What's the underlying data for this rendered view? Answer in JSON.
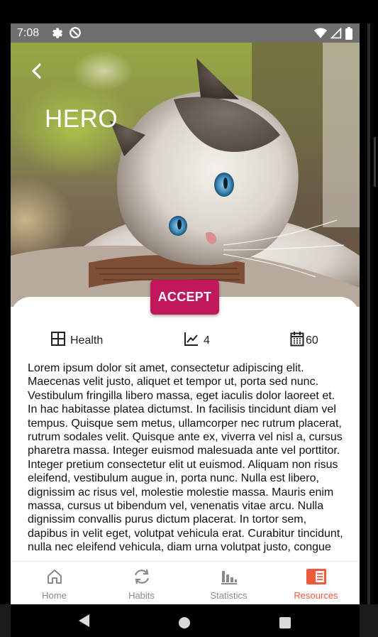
{
  "status_bar": {
    "time": "7:08",
    "left_icons": [
      "settings-icon",
      "sync-icon"
    ],
    "right_icons": [
      "wifi-icon",
      "signal-icon",
      "battery-icon"
    ]
  },
  "hero": {
    "title": "HERO",
    "back_icon": "back-chevron-icon",
    "image": "cat-photo"
  },
  "accept_button": {
    "label": "ACCEPT",
    "color": "#c2185b"
  },
  "info": {
    "category": {
      "icon": "grid-icon",
      "label": "Health"
    },
    "level": {
      "icon": "line-chart-icon",
      "value": "4"
    },
    "days": {
      "icon": "calendar-icon",
      "value": "60"
    }
  },
  "description": "Lorem ipsum dolor sit amet, consectetur adipiscing elit. Maecenas velit justo, aliquet et tempor ut, porta sed nunc. Vestibulum fringilla libero massa, eget iaculis dolor laoreet et. In hac habitasse platea dictumst. In facilisis tincidunt diam vel tempus. Quisque sem metus, ullamcorper nec rutrum placerat, rutrum sodales velit. Quisque ante ex, viverra vel nisl a, cursus pharetra massa. Integer euismod malesuada ante vel porttitor. Integer pretium consectetur elit ut euismod. Aliquam non risus eleifend, vestibulum augue in, porta nunc. Nulla est libero, dignissim ac risus vel, molestie molestie massa. Mauris enim massa, cursus ut bibendum vel, venenatis vitae arcu. Nulla dignissim convallis purus dictum placerat. In tortor sem, dapibus in velit eget, volutpat vehicula erat. Curabitur tincidunt, nulla nec eleifend vehicula, diam urna volutpat justo, congue",
  "bottom_nav": {
    "items": [
      {
        "label": "Home",
        "icon": "home-icon"
      },
      {
        "label": "Habits",
        "icon": "refresh-icon"
      },
      {
        "label": "Statistics",
        "icon": "bar-chart-icon"
      },
      {
        "label": "Resources",
        "icon": "resources-icon",
        "active": true
      }
    ],
    "active_color": "#f05a3c",
    "inactive_color": "#8a8a8a"
  },
  "system_nav": {
    "back": "back-triangle-icon",
    "home": "home-circle-icon",
    "recents": "recents-square-icon"
  }
}
